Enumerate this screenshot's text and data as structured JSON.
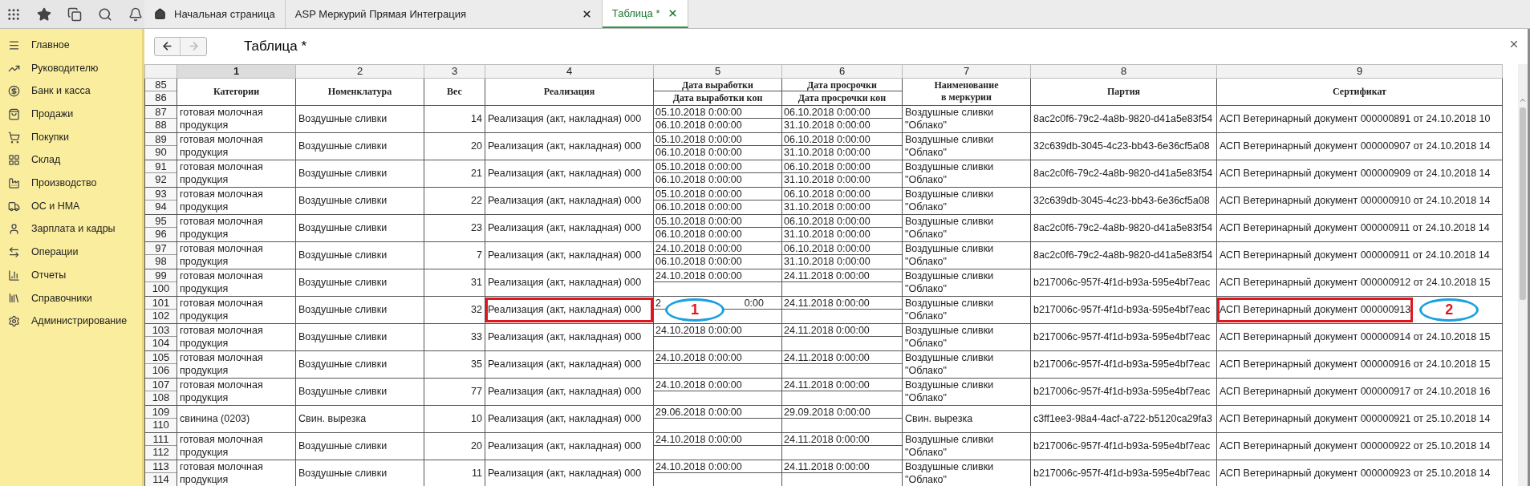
{
  "top_tabs": [
    {
      "label": "Начальная страница",
      "kind": "home",
      "selected": false
    },
    {
      "label": "ASP Меркурий Прямая Интеграция",
      "kind": "closable",
      "selected": false
    },
    {
      "label": "Таблица *",
      "kind": "closable",
      "selected": true
    }
  ],
  "sidebar": {
    "items": [
      {
        "label": "Главное"
      },
      {
        "label": "Руководителю"
      },
      {
        "label": "Банк и касса"
      },
      {
        "label": "Продажи"
      },
      {
        "label": "Покупки"
      },
      {
        "label": "Склад"
      },
      {
        "label": "Производство"
      },
      {
        "label": "ОС и НМА"
      },
      {
        "label": "Зарплата и кадры"
      },
      {
        "label": "Операции"
      },
      {
        "label": "Отчеты"
      },
      {
        "label": "Справочники"
      },
      {
        "label": "Администрирование"
      }
    ]
  },
  "page": {
    "title": "Таблица *",
    "back_enabled": true,
    "forward_enabled": false
  },
  "table": {
    "header_line_numbers": [
      "85",
      "86"
    ],
    "columns": [
      {
        "number": "1",
        "selected": true,
        "kind": "single",
        "header": [
          "Категории"
        ]
      },
      {
        "number": "2",
        "selected": false,
        "kind": "single",
        "header": [
          "Номенклатура"
        ]
      },
      {
        "number": "3",
        "selected": false,
        "kind": "single",
        "header": [
          "Вес"
        ]
      },
      {
        "number": "4",
        "selected": false,
        "kind": "single",
        "header": [
          "Реализация"
        ]
      },
      {
        "number": "5",
        "selected": false,
        "kind": "split",
        "header": [
          "Дата выработки",
          "Дата выработки кон"
        ]
      },
      {
        "number": "6",
        "selected": false,
        "kind": "split",
        "header": [
          "Дата просрочки",
          "Дата просрочки кон"
        ]
      },
      {
        "number": "7",
        "selected": false,
        "kind": "single",
        "header": [
          "Наименование",
          "в меркурии"
        ]
      },
      {
        "number": "8",
        "selected": false,
        "kind": "single",
        "header": [
          "Партия"
        ]
      },
      {
        "number": "9",
        "selected": false,
        "kind": "single",
        "header": [
          "Сертификат"
        ]
      }
    ],
    "rows": [
      {
        "line_numbers": [
          "87",
          "88"
        ],
        "cells": [
          {
            "kind": "text",
            "text": "готовая молочная продукция"
          },
          {
            "kind": "text",
            "text": "Воздушные сливки"
          },
          {
            "kind": "number",
            "text": "14"
          },
          {
            "kind": "text",
            "text": "Реализация (акт, накладная) 000"
          },
          {
            "kind": "pair",
            "top": "05.10.2018 0:00:00",
            "bottom": "06.10.2018 0:00:00"
          },
          {
            "kind": "pair",
            "top": "06.10.2018 0:00:00",
            "bottom": "31.10.2018 0:00:00"
          },
          {
            "kind": "text",
            "text": "Воздушные сливки \"Облако\""
          },
          {
            "kind": "text",
            "text": "8ac2c0f6-79c2-4a8b-9820-d41a5e83f54"
          },
          {
            "kind": "text",
            "text": "АСП Ветеринарный документ 000000891 от 24.10.2018 10"
          }
        ]
      },
      {
        "line_numbers": [
          "89",
          "90"
        ],
        "cells": [
          {
            "kind": "text",
            "text": "готовая молочная продукция"
          },
          {
            "kind": "text",
            "text": "Воздушные сливки"
          },
          {
            "kind": "number",
            "text": "20"
          },
          {
            "kind": "text",
            "text": "Реализация (акт, накладная) 000"
          },
          {
            "kind": "pair",
            "top": "05.10.2018 0:00:00",
            "bottom": "06.10.2018 0:00:00"
          },
          {
            "kind": "pair",
            "top": "06.10.2018 0:00:00",
            "bottom": "31.10.2018 0:00:00"
          },
          {
            "kind": "text",
            "text": "Воздушные сливки \"Облако\""
          },
          {
            "kind": "text",
            "text": "32c639db-3045-4c23-bb43-6e36cf5a08"
          },
          {
            "kind": "text",
            "text": "АСП Ветеринарный документ 000000907 от 24.10.2018 14"
          }
        ]
      },
      {
        "line_numbers": [
          "91",
          "92"
        ],
        "cells": [
          {
            "kind": "text",
            "text": "готовая молочная продукция"
          },
          {
            "kind": "text",
            "text": "Воздушные сливки"
          },
          {
            "kind": "number",
            "text": "21"
          },
          {
            "kind": "text",
            "text": "Реализация (акт, накладная) 000"
          },
          {
            "kind": "pair",
            "top": "05.10.2018 0:00:00",
            "bottom": "06.10.2018 0:00:00"
          },
          {
            "kind": "pair",
            "top": "06.10.2018 0:00:00",
            "bottom": "31.10.2018 0:00:00"
          },
          {
            "kind": "text",
            "text": "Воздушные сливки \"Облако\""
          },
          {
            "kind": "text",
            "text": "8ac2c0f6-79c2-4a8b-9820-d41a5e83f54"
          },
          {
            "kind": "text",
            "text": "АСП Ветеринарный документ 000000909 от 24.10.2018 14"
          }
        ]
      },
      {
        "line_numbers": [
          "93",
          "94"
        ],
        "cells": [
          {
            "kind": "text",
            "text": "готовая молочная продукция"
          },
          {
            "kind": "text",
            "text": "Воздушные сливки"
          },
          {
            "kind": "number",
            "text": "22"
          },
          {
            "kind": "text",
            "text": "Реализация (акт, накладная) 000"
          },
          {
            "kind": "pair",
            "top": "05.10.2018 0:00:00",
            "bottom": "06.10.2018 0:00:00"
          },
          {
            "kind": "pair",
            "top": "06.10.2018 0:00:00",
            "bottom": "31.10.2018 0:00:00"
          },
          {
            "kind": "text",
            "text": "Воздушные сливки \"Облако\""
          },
          {
            "kind": "text",
            "text": "32c639db-3045-4c23-bb43-6e36cf5a08"
          },
          {
            "kind": "text",
            "text": "АСП Ветеринарный документ 000000910 от 24.10.2018 14"
          }
        ]
      },
      {
        "line_numbers": [
          "95",
          "96"
        ],
        "cells": [
          {
            "kind": "text",
            "text": "готовая молочная продукция"
          },
          {
            "kind": "text",
            "text": "Воздушные сливки"
          },
          {
            "kind": "number",
            "text": "23"
          },
          {
            "kind": "text",
            "text": "Реализация (акт, накладная) 000"
          },
          {
            "kind": "pair",
            "top": "05.10.2018 0:00:00",
            "bottom": "06.10.2018 0:00:00"
          },
          {
            "kind": "pair",
            "top": "06.10.2018 0:00:00",
            "bottom": "31.10.2018 0:00:00"
          },
          {
            "kind": "text",
            "text": "Воздушные сливки \"Облако\""
          },
          {
            "kind": "text",
            "text": "8ac2c0f6-79c2-4a8b-9820-d41a5e83f54"
          },
          {
            "kind": "text",
            "text": "АСП Ветеринарный документ 000000911 от 24.10.2018 14"
          }
        ]
      },
      {
        "line_numbers": [
          "97",
          "98"
        ],
        "cells": [
          {
            "kind": "text",
            "text": "готовая молочная продукция"
          },
          {
            "kind": "text",
            "text": "Воздушные сливки"
          },
          {
            "kind": "number",
            "text": "7"
          },
          {
            "kind": "text",
            "text": "Реализация (акт, накладная) 000"
          },
          {
            "kind": "pair",
            "top": "24.10.2018 0:00:00",
            "bottom": "06.10.2018 0:00:00"
          },
          {
            "kind": "pair",
            "top": "06.10.2018 0:00:00",
            "bottom": "31.10.2018 0:00:00"
          },
          {
            "kind": "text",
            "text": "Воздушные сливки \"Облако\""
          },
          {
            "kind": "text",
            "text": "8ac2c0f6-79c2-4a8b-9820-d41a5e83f54"
          },
          {
            "kind": "text",
            "text": "АСП Ветеринарный документ 000000911 от 24.10.2018 14"
          }
        ]
      },
      {
        "line_numbers": [
          "99",
          "100"
        ],
        "cells": [
          {
            "kind": "text",
            "text": "готовая молочная продукция"
          },
          {
            "kind": "text",
            "text": "Воздушные сливки"
          },
          {
            "kind": "number",
            "text": "31"
          },
          {
            "kind": "text",
            "text": "Реализация (акт, накладная) 000"
          },
          {
            "kind": "pair",
            "top": "24.10.2018 0:00:00"
          },
          {
            "kind": "pair",
            "top": "24.11.2018 0:00:00"
          },
          {
            "kind": "text",
            "text": "Воздушные сливки \"Облако\""
          },
          {
            "kind": "text",
            "text": "b217006c-957f-4f1d-b93a-595e4bf7eac"
          },
          {
            "kind": "text",
            "text": "АСП Ветеринарный документ 000000912 от 24.10.2018 15"
          }
        ]
      },
      {
        "line_numbers": [
          "101",
          "102"
        ],
        "cells": [
          {
            "kind": "text",
            "text": "готовая молочная продукция"
          },
          {
            "kind": "text",
            "text": "Воздушные сливки"
          },
          {
            "kind": "number",
            "text": "32"
          },
          {
            "kind": "text",
            "text": "Реализация (акт, накладная) 000",
            "highlighted": true
          },
          {
            "kind": "covered",
            "parts": [
              "2",
              "0:00"
            ],
            "callout": "1"
          },
          {
            "kind": "pair",
            "top": "24.11.2018 0:00:00"
          },
          {
            "kind": "text",
            "text": "Воздушные сливки \"Облако\""
          },
          {
            "kind": "text",
            "text": "b217006c-957f-4f1d-b93a-595e4bf7eac"
          },
          {
            "kind": "text",
            "text": "АСП Ветеринарный документ 000000913",
            "highlighted": true,
            "callout": "2"
          }
        ]
      },
      {
        "line_numbers": [
          "103",
          "104"
        ],
        "cells": [
          {
            "kind": "text",
            "text": "готовая молочная продукция"
          },
          {
            "kind": "text",
            "text": "Воздушные сливки"
          },
          {
            "kind": "number",
            "text": "33"
          },
          {
            "kind": "text",
            "text": "Реализация (акт, накладная) 000"
          },
          {
            "kind": "pair",
            "top": "24.10.2018 0:00:00"
          },
          {
            "kind": "pair",
            "top": "24.11.2018 0:00:00"
          },
          {
            "kind": "text",
            "text": "Воздушные сливки \"Облако\""
          },
          {
            "kind": "text",
            "text": "b217006c-957f-4f1d-b93a-595e4bf7eac"
          },
          {
            "kind": "text",
            "text": "АСП Ветеринарный документ 000000914 от 24.10.2018 15"
          }
        ]
      },
      {
        "line_numbers": [
          "105",
          "106"
        ],
        "cells": [
          {
            "kind": "text",
            "text": "готовая молочная продукция"
          },
          {
            "kind": "text",
            "text": "Воздушные сливки"
          },
          {
            "kind": "number",
            "text": "35"
          },
          {
            "kind": "text",
            "text": "Реализация (акт, накладная) 000"
          },
          {
            "kind": "pair",
            "top": "24.10.2018 0:00:00"
          },
          {
            "kind": "pair",
            "top": "24.11.2018 0:00:00"
          },
          {
            "kind": "text",
            "text": "Воздушные сливки \"Облако\""
          },
          {
            "kind": "text",
            "text": "b217006c-957f-4f1d-b93a-595e4bf7eac"
          },
          {
            "kind": "text",
            "text": "АСП Ветеринарный документ 000000916 от 24.10.2018 15"
          }
        ]
      },
      {
        "line_numbers": [
          "107",
          "108"
        ],
        "cells": [
          {
            "kind": "text",
            "text": "готовая молочная продукция"
          },
          {
            "kind": "text",
            "text": "Воздушные сливки"
          },
          {
            "kind": "number",
            "text": "77"
          },
          {
            "kind": "text",
            "text": "Реализация (акт, накладная) 000"
          },
          {
            "kind": "pair",
            "top": "24.10.2018 0:00:00"
          },
          {
            "kind": "pair",
            "top": "24.11.2018 0:00:00"
          },
          {
            "kind": "text",
            "text": "Воздушные сливки \"Облако\""
          },
          {
            "kind": "text",
            "text": "b217006c-957f-4f1d-b93a-595e4bf7eac"
          },
          {
            "kind": "text",
            "text": "АСП Ветеринарный документ 000000917 от 24.10.2018 16"
          }
        ]
      },
      {
        "line_numbers": [
          "109",
          "110"
        ],
        "cells": [
          {
            "kind": "text",
            "text": "свинина (0203)"
          },
          {
            "kind": "text",
            "text": "Свин. вырезка"
          },
          {
            "kind": "number",
            "text": "10"
          },
          {
            "kind": "text",
            "text": "Реализация (акт, накладная) 000"
          },
          {
            "kind": "pair",
            "top": "29.06.2018 0:00:00"
          },
          {
            "kind": "pair",
            "top": "29.09.2018 0:00:00"
          },
          {
            "kind": "text",
            "text": "Свин. вырезка"
          },
          {
            "kind": "text",
            "text": "c3ff1ee3-98a4-4acf-a722-b5120ca29fa3"
          },
          {
            "kind": "text",
            "text": "АСП Ветеринарный документ 000000921 от 25.10.2018 14"
          }
        ]
      },
      {
        "line_numbers": [
          "111",
          "112"
        ],
        "cells": [
          {
            "kind": "text",
            "text": "готовая молочная продукция"
          },
          {
            "kind": "text",
            "text": "Воздушные сливки"
          },
          {
            "kind": "number",
            "text": "20"
          },
          {
            "kind": "text",
            "text": "Реализация (акт, накладная) 000"
          },
          {
            "kind": "pair",
            "top": "24.10.2018 0:00:00"
          },
          {
            "kind": "pair",
            "top": "24.11.2018 0:00:00"
          },
          {
            "kind": "text",
            "text": "Воздушные сливки \"Облако\""
          },
          {
            "kind": "text",
            "text": "b217006c-957f-4f1d-b93a-595e4bf7eac"
          },
          {
            "kind": "text",
            "text": "АСП Ветеринарный документ 000000922 от 25.10.2018 14"
          }
        ]
      },
      {
        "line_numbers": [
          "113",
          "114"
        ],
        "cells": [
          {
            "kind": "text",
            "text": "готовая молочная продукция"
          },
          {
            "kind": "text",
            "text": "Воздушные сливки"
          },
          {
            "kind": "number",
            "text": "11"
          },
          {
            "kind": "text",
            "text": "Реализация (акт, накладная) 000"
          },
          {
            "kind": "pair",
            "top": "24.10.2018 0:00:00"
          },
          {
            "kind": "pair",
            "top": "24.11.2018 0:00:00"
          },
          {
            "kind": "text",
            "text": "Воздушные сливки \"Облако\""
          },
          {
            "kind": "text",
            "text": "b217006c-957f-4f1d-b93a-595e4bf7eac"
          },
          {
            "kind": "text",
            "text": "АСП Ветеринарный документ 000000923 от 25.10.2018 14"
          }
        ]
      }
    ]
  }
}
